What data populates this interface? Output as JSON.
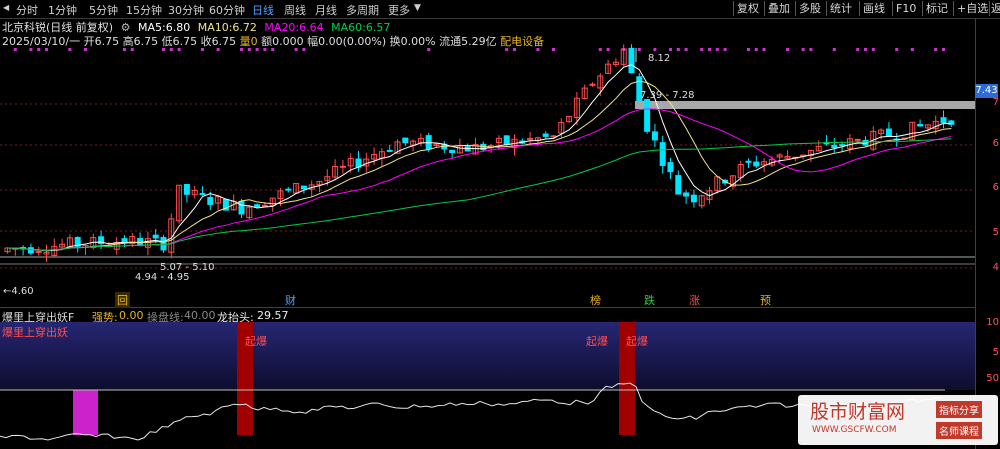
{
  "toolbar": {
    "timeframes": [
      "分时",
      "1分钟",
      "5分钟",
      "15分钟",
      "30分钟",
      "60分钟",
      "日线",
      "周线",
      "月线",
      "多周期",
      "更多"
    ],
    "active": "日线",
    "right_buttons": [
      "复权",
      "叠加",
      "多股",
      "统计",
      "画线",
      "F10",
      "标记",
      "+自选",
      "返"
    ]
  },
  "info": {
    "stock_title": "北京科锐(日线 前复权)",
    "ma5_label": "MA5:",
    "ma5": "6.80",
    "ma10_label": "MA10:",
    "ma10": "6.72",
    "ma20_label": "MA20:",
    "ma20": "6.64",
    "ma60_label": "MA60:",
    "ma60": "6.57",
    "date": "2025/03/10/一",
    "open": "开6.75",
    "high": "高6.75",
    "low": "低6.75",
    "close": "收6.75",
    "volume": "量0",
    "amount": "额0.000",
    "change": "幅0.00(0.00%)",
    "turnover": "换0.00%",
    "float": "流通5.29亿",
    "sector": "配电设备"
  },
  "price_axis": {
    "ticks": [
      "7",
      "6",
      "6",
      "5",
      "4"
    ],
    "current_price": "7.43"
  },
  "annotations": {
    "high_value": "8.12",
    "resistance": "7.39 - 7.28",
    "support_1": "5.07 - 5.10",
    "support_2": "4.94 - 4.95",
    "low_value": "4.60"
  },
  "events": [
    {
      "label": "回",
      "color": "#e6b422"
    },
    {
      "label": "财",
      "color": "#4da3ff"
    },
    {
      "label": "榜",
      "color": "#e6b422"
    },
    {
      "label": "跌",
      "color": "#2ecc40"
    },
    {
      "label": "涨",
      "color": "#ff4d4d"
    },
    {
      "label": "预",
      "color": "#e6b422"
    }
  ],
  "indicator": {
    "name": "爆里上穿出妖F",
    "strength_label": "强势:",
    "strength": "0.00",
    "control_label": "操盘线:",
    "control": "40.00",
    "dragon_label": "龙抬头:",
    "dragon": "29.57",
    "panel_title": "爆里上穿出妖",
    "signals": [
      "起爆",
      "起爆",
      "起爆"
    ],
    "axis_ticks": [
      "10",
      "5",
      "50"
    ]
  },
  "watermark": {
    "title": "股市财富网",
    "url": "WWW.GSCFW.COM",
    "tag1": "指标分享",
    "tag2": "名师课程"
  },
  "colors": {
    "up": "#ff4d4d",
    "down": "#00e5ff",
    "ma5": "#ffffff",
    "ma10": "#f0e68c",
    "ma20": "#ff00ff",
    "ma60": "#00cc44"
  }
}
